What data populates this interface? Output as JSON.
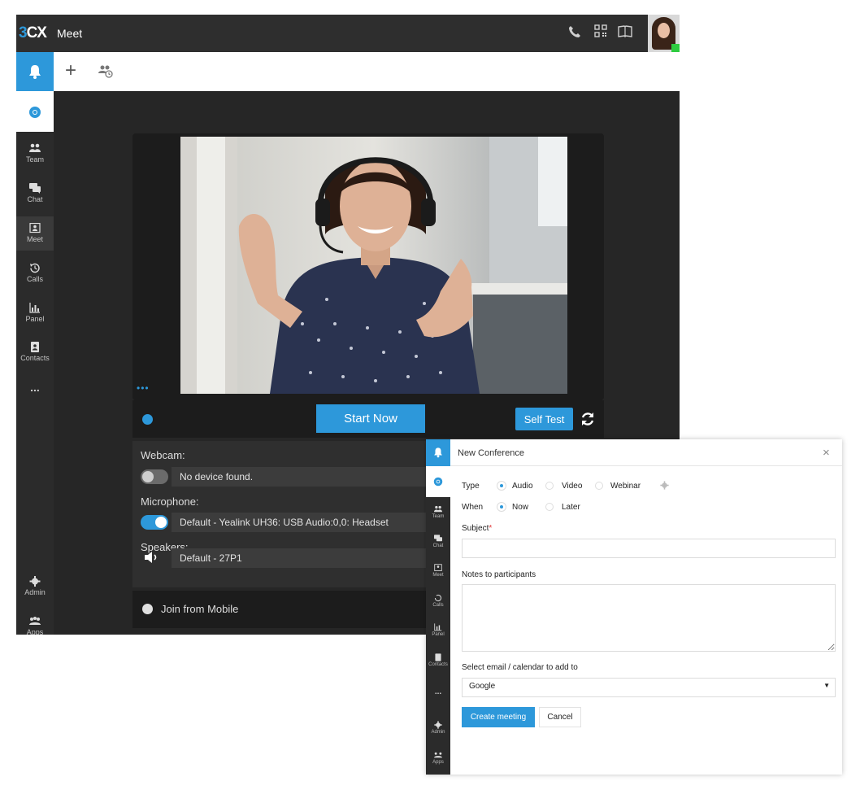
{
  "app": {
    "logo": {
      "num": "3",
      "text": "CX"
    },
    "title": "Meet",
    "topbar_icons": [
      "phone-icon",
      "qr-code-icon",
      "book-icon"
    ],
    "colors": {
      "accent": "#2d98da",
      "topbar": "#2e2e2e",
      "sidebar": "#2b2b2b",
      "online": "#2ecc40"
    }
  },
  "sidebar": {
    "items": [
      {
        "label": "Team",
        "icon": "team-icon"
      },
      {
        "label": "Chat",
        "icon": "chat-icon"
      },
      {
        "label": "Meet",
        "icon": "meet-icon",
        "active": true
      },
      {
        "label": "Calls",
        "icon": "calls-history-icon"
      },
      {
        "label": "Panel",
        "icon": "panel-chart-icon"
      },
      {
        "label": "Contacts",
        "icon": "contacts-icon"
      },
      {
        "label": "...",
        "icon": "more-icon"
      }
    ],
    "bottom": [
      {
        "label": "Admin",
        "icon": "gear-icon"
      },
      {
        "label": "Apps",
        "icon": "apps-icon"
      }
    ]
  },
  "meeting": {
    "more": "•••",
    "start_button": "Start Now",
    "self_test_button": "Self Test",
    "webcam_label": "Webcam:",
    "webcam_value": "No device found.",
    "webcam_enabled": false,
    "microphone_label": "Microphone:",
    "microphone_value": "Default - Yealink UH36: USB Audio:0,0: Headset",
    "microphone_enabled": true,
    "speakers_label": "Speakers:",
    "speakers_value": "Default - 27P1",
    "join_mobile": "Join from Mobile"
  },
  "dialog": {
    "title": "New Conference",
    "close": "×",
    "type_label": "Type",
    "type_options": [
      {
        "label": "Audio",
        "selected": true
      },
      {
        "label": "Video",
        "selected": false
      },
      {
        "label": "Webinar",
        "selected": false
      }
    ],
    "when_label": "When",
    "when_options": [
      {
        "label": "Now",
        "selected": true
      },
      {
        "label": "Later",
        "selected": false
      }
    ],
    "subject_label": "Subject",
    "required_mark": "*",
    "subject_value": "",
    "notes_label": "Notes to participants",
    "notes_value": "",
    "calendar_label": "Select email / calendar to add to",
    "calendar_value": "Google",
    "create_button": "Create meeting",
    "cancel_button": "Cancel",
    "sidebar": {
      "items": [
        {
          "label": "Team"
        },
        {
          "label": "Chat"
        },
        {
          "label": "Meet"
        },
        {
          "label": "Calls"
        },
        {
          "label": "Panel"
        },
        {
          "label": "Contacts"
        },
        {
          "label": "..."
        }
      ],
      "bottom": [
        {
          "label": "Admin"
        },
        {
          "label": "Apps"
        }
      ]
    }
  }
}
